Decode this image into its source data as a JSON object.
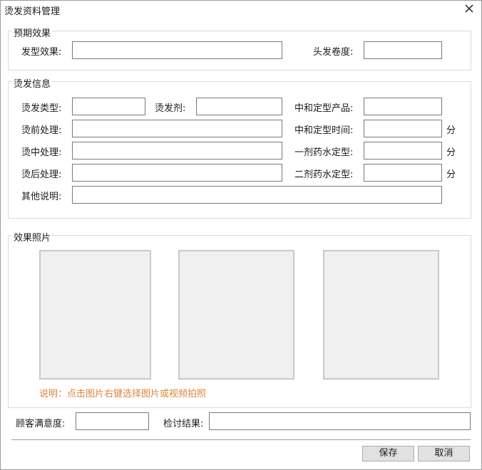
{
  "window": {
    "title": "烫发资料管理",
    "close_icon": "close-icon"
  },
  "expected": {
    "legend": "预期效果",
    "style_effect_label": "发型效果:",
    "style_effect_value": "",
    "curl_label": "头发卷度:",
    "curl_value": ""
  },
  "perm": {
    "legend": "烫发信息",
    "type_label": "烫发类型:",
    "type_value": "",
    "agent_label": "烫发剂:",
    "agent_value": "",
    "neutralizer_label": "中和定型产品:",
    "neutralizer_value": "",
    "pre_label": "烫前处理:",
    "pre_value": "",
    "neutral_time_label": "中和定型时间:",
    "neutral_time_value": "",
    "mid_label": "烫中处理:",
    "mid_value": "",
    "first_agent_label": "一剂药水定型:",
    "first_agent_value": "",
    "post_label": "烫后处理:",
    "post_value": "",
    "second_agent_label": "二剂药水定型:",
    "second_agent_value": "",
    "other_label": "其他说明:",
    "other_value": "",
    "unit_minute": "分"
  },
  "photos": {
    "legend": "效果照片",
    "hint": "说明：点击图片右键选择图片或视频拍照"
  },
  "satisfaction": {
    "label": "顾客满意度:",
    "value": ""
  },
  "review": {
    "label": "检讨结果:",
    "value": ""
  },
  "buttons": {
    "save": "保存",
    "cancel": "取消"
  },
  "colors": {
    "hint": "#e0843a",
    "photo_bg": "#f0f0f0"
  }
}
